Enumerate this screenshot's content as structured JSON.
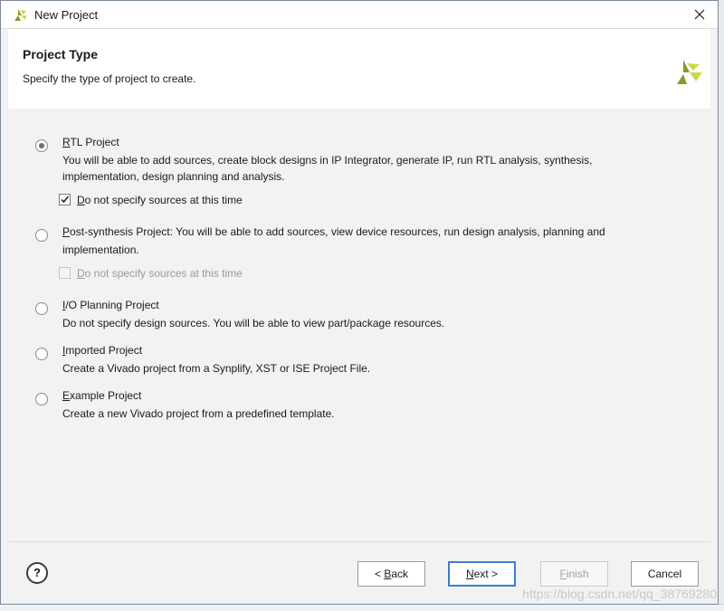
{
  "window": {
    "title": "New Project"
  },
  "header": {
    "title": "Project Type",
    "subtitle": "Specify the type of project to create."
  },
  "options": [
    {
      "mnemonic": "R",
      "title_rest": "TL Project",
      "description": "You will be able to add sources, create block designs in IP Integrator, generate IP, run RTL analysis, synthesis, implementation, design planning and analysis.",
      "selected": true
    },
    {
      "mnemonic": "P",
      "title_rest": "ost-synthesis Project",
      "inline_description": ": You will be able to add sources, view device resources, run design analysis, planning and",
      "description": "implementation.",
      "selected": false
    },
    {
      "mnemonic": "I",
      "title_rest": "/O Planning Project",
      "description": "Do not specify design sources. You will be able to view part/package resources.",
      "selected": false
    },
    {
      "mnemonic": "I",
      "title_rest": "mported Project",
      "description": "Create a Vivado project from a Synplify, XST or ISE Project File.",
      "selected": false
    },
    {
      "mnemonic": "E",
      "title_rest": "xample Project",
      "description": "Create a new Vivado project from a predefined template.",
      "selected": false
    }
  ],
  "checkboxes": {
    "rtl_no_sources": {
      "mnemonic": "D",
      "label_rest": "o not specify sources at this time",
      "checked": true,
      "enabled": true
    },
    "post_no_sources": {
      "mnemonic": "D",
      "label_rest": "o not specify sources at this time",
      "checked": false,
      "enabled": false
    }
  },
  "footer": {
    "help_glyph": "?",
    "back_prefix": "< ",
    "back_mnemonic": "B",
    "back_rest": "ack",
    "next_mnemonic": "N",
    "next_rest": "ext >",
    "finish_mnemonic": "F",
    "finish_rest": "inish",
    "cancel_label": "Cancel"
  },
  "watermark": "https://blog.csdn.net/qq_38769280",
  "colors": {
    "accent_blue": "#3d7bd5",
    "logo_dark": "#8a9a2a",
    "logo_light": "#c9d94a"
  },
  "icons": {
    "app": "vivado-logo-icon",
    "close": "close-icon",
    "help": "help-icon"
  }
}
